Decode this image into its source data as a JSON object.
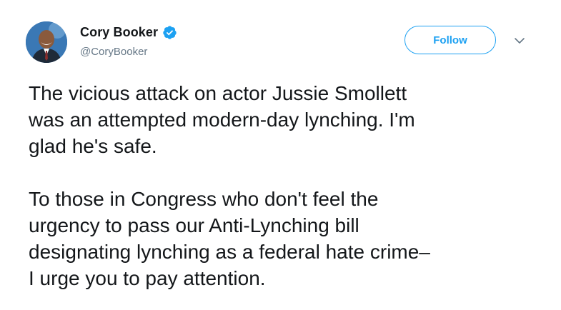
{
  "author": {
    "display_name": "Cory Booker",
    "handle": "@CoryBooker",
    "verified": true,
    "verified_color": "#1da1f2"
  },
  "actions": {
    "follow_label": "Follow",
    "follow_color": "#1da1f2",
    "menu_icon": "chevron-down-icon"
  },
  "tweet": {
    "paragraphs": [
      [
        "The vicious attack on actor Jussie Smollett",
        "was an attempted modern-day lynching. I'm",
        "glad he's safe."
      ],
      [
        "To those in Congress who don't feel the",
        "urgency to pass our Anti-Lynching bill",
        "designating lynching as a federal hate crime–",
        "I urge you to pay attention."
      ]
    ]
  }
}
